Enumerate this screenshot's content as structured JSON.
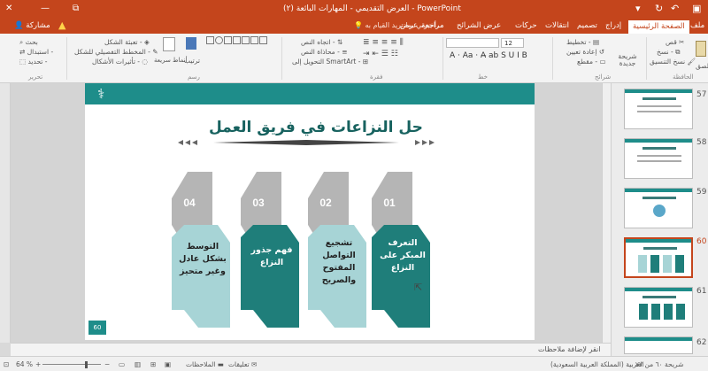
{
  "titlebar": {
    "title": "العرض التقديمي - المهارات البائعة (٢) - PowerPoint",
    "accent": "#c4451c"
  },
  "tabs": [
    {
      "label": "ملف"
    },
    {
      "label": "الصفحة الرئيسية",
      "active": true
    },
    {
      "label": "إدراج"
    },
    {
      "label": "تصميم"
    },
    {
      "label": "انتقالات"
    },
    {
      "label": "حركات"
    },
    {
      "label": "عرض الشرائح"
    },
    {
      "label": "مراجعة"
    },
    {
      "label": "عرض"
    }
  ],
  "tell_me": "أخبرني بما تريد القيام به...",
  "share": "مشاركة",
  "ribbon": {
    "clipboard": {
      "paste": "لصق",
      "cut": "قص",
      "copy": "نسخ -",
      "format_painter": "نسخ التنسيق",
      "group": "الحافظة"
    },
    "slides": {
      "new_slide": "شريحة جديدة",
      "layout": "تخطيط -",
      "reset": "إعادة تعيين",
      "section": "مقطع -",
      "group": "شرائح"
    },
    "font": {
      "size": "12",
      "group": "خط"
    },
    "paragraph": {
      "text_direction": "اتجاه النص -",
      "align_text": "محاذاة النص -",
      "smartart": "التحويل إلى SmartArt -",
      "group": "فقرة"
    },
    "drawing": {
      "arrange": "ترتيب",
      "quick_styles": "أنماط سريعة",
      "fill": "تعبئة الشكل -",
      "outline": "المخطط التفصيلي للشكل -",
      "effects": "تأثيرات الأشكال -",
      "group": "رسم"
    },
    "editing": {
      "find": "بحث",
      "replace": "استبدال -",
      "select": "تحديد -",
      "group": "تحرير"
    }
  },
  "slide": {
    "title": "حل النزاعات في فريق العمل",
    "slide_number": "60",
    "cards": [
      {
        "number": "01",
        "text": "التعرف المبكر على النزاع",
        "style": "dark"
      },
      {
        "number": "02",
        "text": "تشجيع التواصل المفتوح والصريح",
        "style": "light"
      },
      {
        "number": "03",
        "text": "فهم جذور النزاع",
        "style": "dark"
      },
      {
        "number": "04",
        "text": "التوسط بشكل عادل وغير متحيز",
        "style": "light"
      }
    ],
    "colors": {
      "teal": "#1e8d8a",
      "dark_tab": "#1f7e7a",
      "light_tab": "#a7d4d6",
      "gray_tab": "#b5b5b5"
    }
  },
  "notes_placeholder": "انقر لإضافة ملاحظات",
  "thumbnails": [
    {
      "number": "57"
    },
    {
      "number": "58"
    },
    {
      "number": "59"
    },
    {
      "number": "60",
      "selected": true
    },
    {
      "number": "61"
    },
    {
      "number": "62"
    }
  ],
  "status": {
    "slide_info": "شريحة ٦٠ من ٧٧",
    "language": "العربية (المملكة العربية السعودية)",
    "notes": "الملاحظات",
    "comments": "تعليقات",
    "zoom": "64 %"
  }
}
